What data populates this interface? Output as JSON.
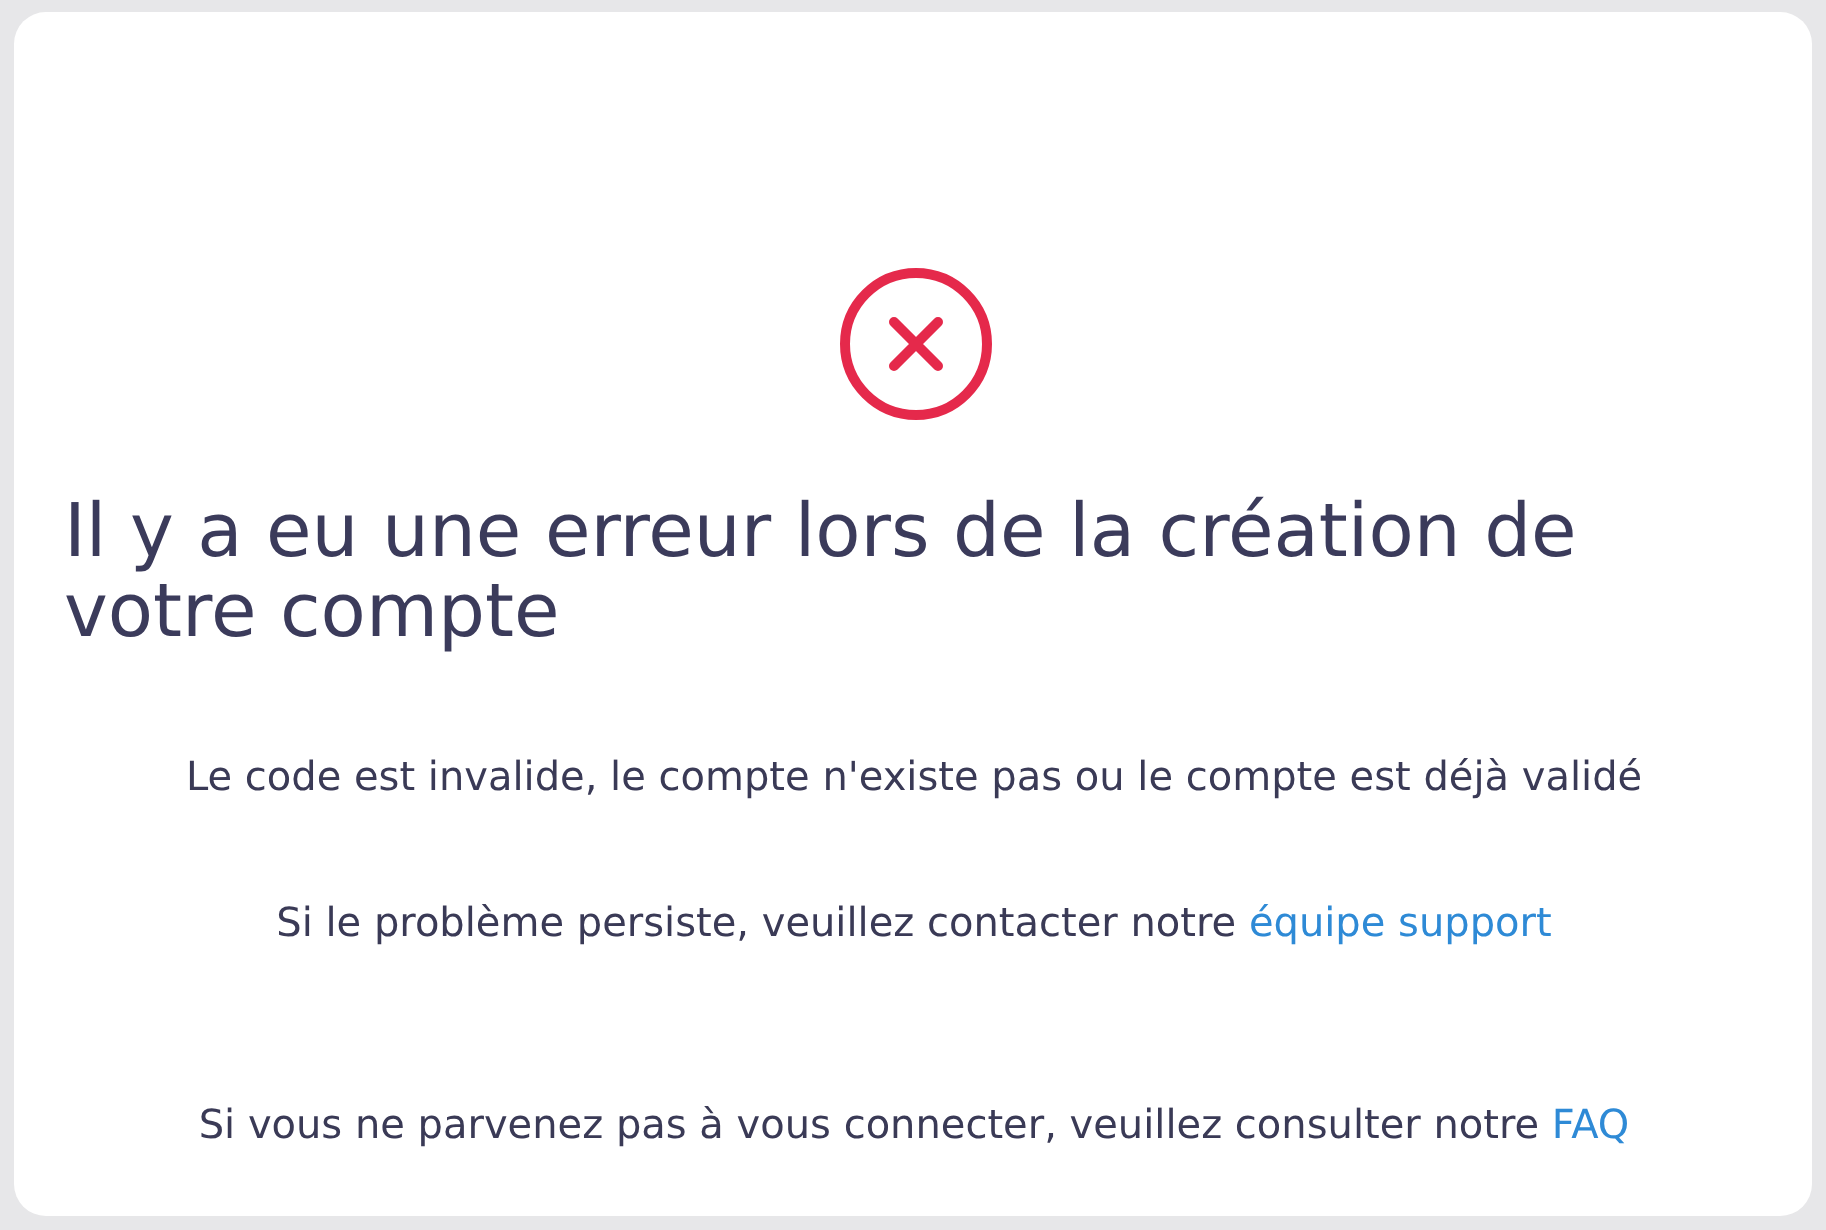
{
  "heading": "Il y a eu une erreur lors de la création de votre compte",
  "messages": [
    {
      "text": "Le code est invalide, le compte n'existe pas ou le compte est déjà validé"
    },
    {
      "text": "Si le problème persiste, veuillez contacter notre",
      "link": "équipe support"
    }
  ],
  "footer_note": {
    "text": "Si vous ne parvenez pas à vous connecter, veuillez consulter notre",
    "link": "FAQ"
  }
}
